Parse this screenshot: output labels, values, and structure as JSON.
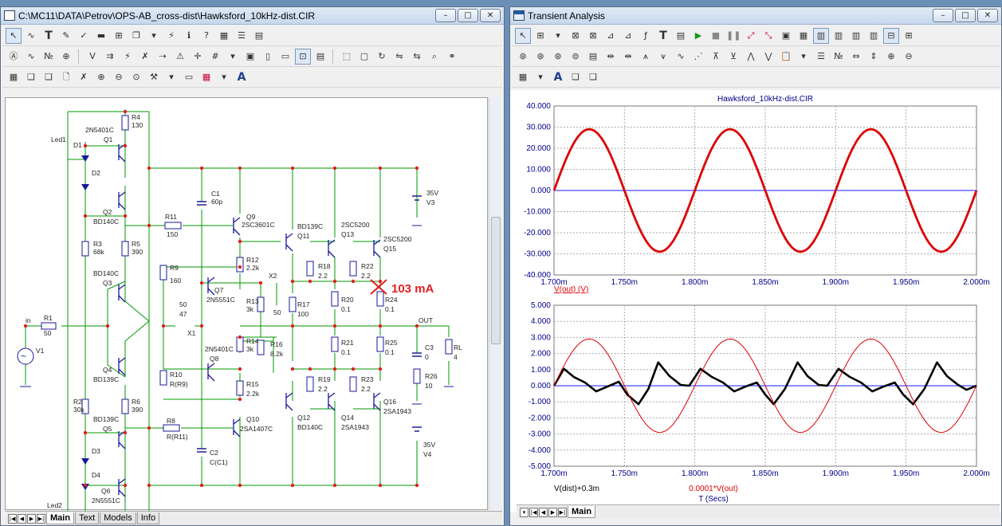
{
  "left_window": {
    "title": "C:\\MC11\\DATA\\Petrov\\OPS-AB_cross-dist\\Hawksford_10kHz-dist.CIR",
    "tabs": [
      "Main",
      "Text",
      "Models",
      "Info"
    ],
    "active_tab": "Main"
  },
  "right_window": {
    "title": "Transient Analysis",
    "tabs": [
      "Main"
    ],
    "active_tab": "Main"
  },
  "window_buttons": {
    "minimize": "–",
    "maximize": "□",
    "close": "✕"
  },
  "nav_arrows": [
    "|◀",
    "◀",
    "▶",
    "▶|"
  ],
  "annotation": "103 mA",
  "components": {
    "R4": [
      "R4",
      "130"
    ],
    "R3": [
      "R3",
      "68k"
    ],
    "R5": [
      "R5",
      "390"
    ],
    "R1": [
      "R1",
      "50"
    ],
    "R2": [
      "R2",
      "30k"
    ],
    "R6": [
      "R6",
      "390"
    ],
    "R11": [
      "R11",
      "150"
    ],
    "R8": [
      "R8",
      "R(R11)"
    ],
    "R9": [
      "R9",
      "160"
    ],
    "R10": [
      "R10",
      "R(R9)"
    ],
    "R12": [
      "R12",
      "2.2k"
    ],
    "R13": [
      "R13",
      "3k"
    ],
    "R14": [
      "R14",
      "3k"
    ],
    "R15": [
      "R15",
      "2.2k"
    ],
    "R16": [
      "R16",
      "8.2k"
    ],
    "R17": [
      "R17",
      "100"
    ],
    "R18": [
      "R18",
      "2.2"
    ],
    "R19": [
      "R19",
      "2.2"
    ],
    "R20": [
      "R20",
      "0.1"
    ],
    "R21": [
      "R21",
      "0.1"
    ],
    "R22": [
      "R22",
      "2.2"
    ],
    "R23": [
      "R23",
      "2.2"
    ],
    "R24": [
      "R24",
      "0.1"
    ],
    "R25": [
      "R25",
      "0.1"
    ],
    "R26": [
      "R26",
      "10"
    ],
    "RL": [
      "RL",
      "4"
    ],
    "C1": [
      "C1",
      "60p"
    ],
    "C2": [
      "C2",
      "C(C1)"
    ],
    "C3": [
      "C3",
      "0"
    ],
    "V1": [
      "V1"
    ],
    "V3": [
      "35V",
      "V3"
    ],
    "V4": [
      "35V",
      "V4"
    ],
    "X1": [
      "X1"
    ],
    "X2": [
      "X2"
    ],
    "pot1": [
      "50",
      "47"
    ],
    "pot2": [
      "50"
    ],
    "Q1": [
      "2N5401C",
      "Q1"
    ],
    "Q2": [
      "Q2",
      "BD140C"
    ],
    "Q3": [
      "BD140C",
      "Q3"
    ],
    "Q4": [
      "Q4",
      "BD139C"
    ],
    "Q5": [
      "BD139C",
      "Q5"
    ],
    "Q6": [
      "Q6",
      "2N5551C"
    ],
    "Q7": [
      "Q7",
      "2N5551C"
    ],
    "Q8": [
      "2N5401C",
      "Q8"
    ],
    "Q9": [
      "Q9",
      "2SC3601C"
    ],
    "Q10": [
      "Q10",
      "2SA1407C"
    ],
    "Q11": [
      "BD139C",
      "Q11"
    ],
    "Q12": [
      "Q12",
      "BD140C"
    ],
    "Q13": [
      "2SC5200",
      "Q13"
    ],
    "Q14": [
      "Q14",
      "2SA1943"
    ],
    "Q15": [
      "2SC5200",
      "Q15"
    ],
    "Q16": [
      "Q16",
      "2SA1943"
    ],
    "D1": [
      "D1"
    ],
    "D2": [
      "D2"
    ],
    "D3": [
      "D3"
    ],
    "D4": [
      "D4"
    ],
    "Led1": [
      "Led1"
    ],
    "Led2": [
      "Led2"
    ],
    "in": [
      "in"
    ],
    "OUT": [
      "OUT"
    ]
  },
  "chart_data": [
    {
      "type": "line",
      "title": "Hawksford_10kHz-dist.CIR",
      "xlabel": "",
      "ylabel": "",
      "x_range": [
        0.0017,
        0.002
      ],
      "ylim": [
        -40,
        40
      ],
      "x_ticks": [
        "1.700m",
        "1.750m",
        "1.800m",
        "1.850m",
        "1.900m",
        "1.950m",
        "2.000m"
      ],
      "y_ticks": [
        "40.000",
        "30.000",
        "20.000",
        "10.000",
        "0.000",
        "-10.000",
        "-20.000",
        "-30.000",
        "-40.000"
      ],
      "grid": true,
      "series": [
        {
          "name": "V(out) (V)",
          "color": "#dd0000",
          "form": "sine",
          "frequency_hz": 10000,
          "amplitude": 29,
          "phase_zero_time": 0.0017
        }
      ]
    },
    {
      "type": "line",
      "xlabel": "T (Secs)",
      "ylabel": "",
      "x_range": [
        0.0017,
        0.002
      ],
      "ylim": [
        -5,
        5
      ],
      "x_ticks": [
        "1.700m",
        "1.750m",
        "1.800m",
        "1.850m",
        "1.900m",
        "1.950m",
        "2.000m"
      ],
      "y_ticks": [
        "5.000",
        "4.000",
        "3.000",
        "2.000",
        "1.000",
        "0.000",
        "-1.000",
        "-2.000",
        "-3.000",
        "-4.000",
        "-5.000"
      ],
      "grid": true,
      "series": [
        {
          "name": "V(dist)+0.3m",
          "color": "#000000",
          "points": [
            [
              0.0017,
              0.0
            ],
            [
              0.001707,
              1.05
            ],
            [
              0.001714,
              0.55
            ],
            [
              0.001722,
              0.2
            ],
            [
              0.00173,
              -0.35
            ],
            [
              0.001738,
              -0.05
            ],
            [
              0.001746,
              0.25
            ],
            [
              0.001752,
              -0.55
            ],
            [
              0.00176,
              -1.15
            ],
            [
              0.001767,
              -0.2
            ],
            [
              0.001774,
              1.45
            ],
            [
              0.001782,
              0.6
            ],
            [
              0.00179,
              0.05
            ],
            [
              0.001796,
              0.0
            ],
            [
              0.001804,
              1.05
            ],
            [
              0.001812,
              0.55
            ],
            [
              0.00182,
              0.2
            ],
            [
              0.001828,
              -0.35
            ],
            [
              0.001836,
              -0.05
            ],
            [
              0.001844,
              0.2
            ],
            [
              0.00185,
              -0.55
            ],
            [
              0.001856,
              -1.15
            ],
            [
              0.001864,
              -0.2
            ],
            [
              0.001873,
              1.45
            ],
            [
              0.00188,
              0.6
            ],
            [
              0.001888,
              0.05
            ],
            [
              0.001894,
              0.0
            ],
            [
              0.001902,
              1.05
            ],
            [
              0.00191,
              0.55
            ],
            [
              0.001918,
              0.2
            ],
            [
              0.001926,
              -0.35
            ],
            [
              0.001934,
              -0.05
            ],
            [
              0.001942,
              0.2
            ],
            [
              0.001948,
              -0.55
            ],
            [
              0.001955,
              -1.15
            ],
            [
              0.001963,
              -0.2
            ],
            [
              0.001972,
              1.45
            ],
            [
              0.001979,
              0.6
            ],
            [
              0.001987,
              0.05
            ],
            [
              0.001993,
              -0.25
            ],
            [
              0.002,
              0.0
            ]
          ]
        },
        {
          "name": "0.0001*V(out)",
          "color": "#dd0000",
          "form": "sine",
          "frequency_hz": 10000,
          "amplitude": 2.9,
          "phase_zero_time": 0.0017
        }
      ]
    }
  ]
}
